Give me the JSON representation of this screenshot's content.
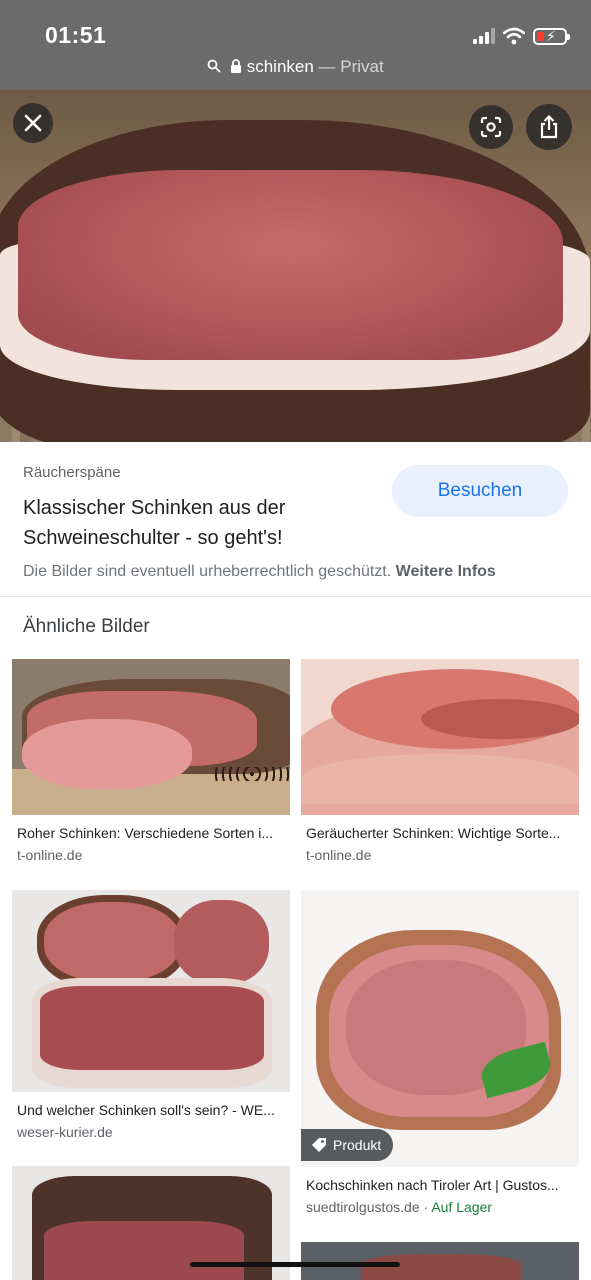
{
  "status_bar": {
    "time": "01:51"
  },
  "url_bar": {
    "host": "schinken",
    "separator": " — ",
    "mode": "Privat"
  },
  "icons": {
    "search": "search-icon",
    "lock": "lock-icon",
    "close": "close-icon",
    "lens": "lens-icon",
    "share": "share-icon",
    "tag": "tag-icon"
  },
  "result": {
    "source": "Räucherspäne",
    "title": "Klassischer Schinken aus der Schweineschulter - so geht's!",
    "search_button": "Besuchen",
    "copyright_text": "Die Bilder sind eventuell urheberrechtlich geschützt.",
    "copyright_link": "Weitere Infos"
  },
  "similar": {
    "heading": "Ähnliche Bilder",
    "items": [
      {
        "title": "Roher Schinken: Verschiedene Sorten i...",
        "domain": "t-online.de"
      },
      {
        "title": "Geräucherter Schinken: Wichtige Sorte...",
        "domain": "t-online.de"
      },
      {
        "title": "Und welcher Schinken soll's sein? - WE...",
        "domain": "weser-kurier.de"
      },
      {
        "title": "Kochschinken nach Tiroler Art | Gustos...",
        "domain": "suedtirolgustos.de",
        "separator": " · ",
        "stock": "Auf Lager",
        "badge": "Produkt"
      }
    ]
  },
  "colors": {
    "accent": "#1a73e8",
    "accent_bg": "#e8f0fe",
    "in_stock": "#188038",
    "topbar": "#6b6b6b"
  }
}
